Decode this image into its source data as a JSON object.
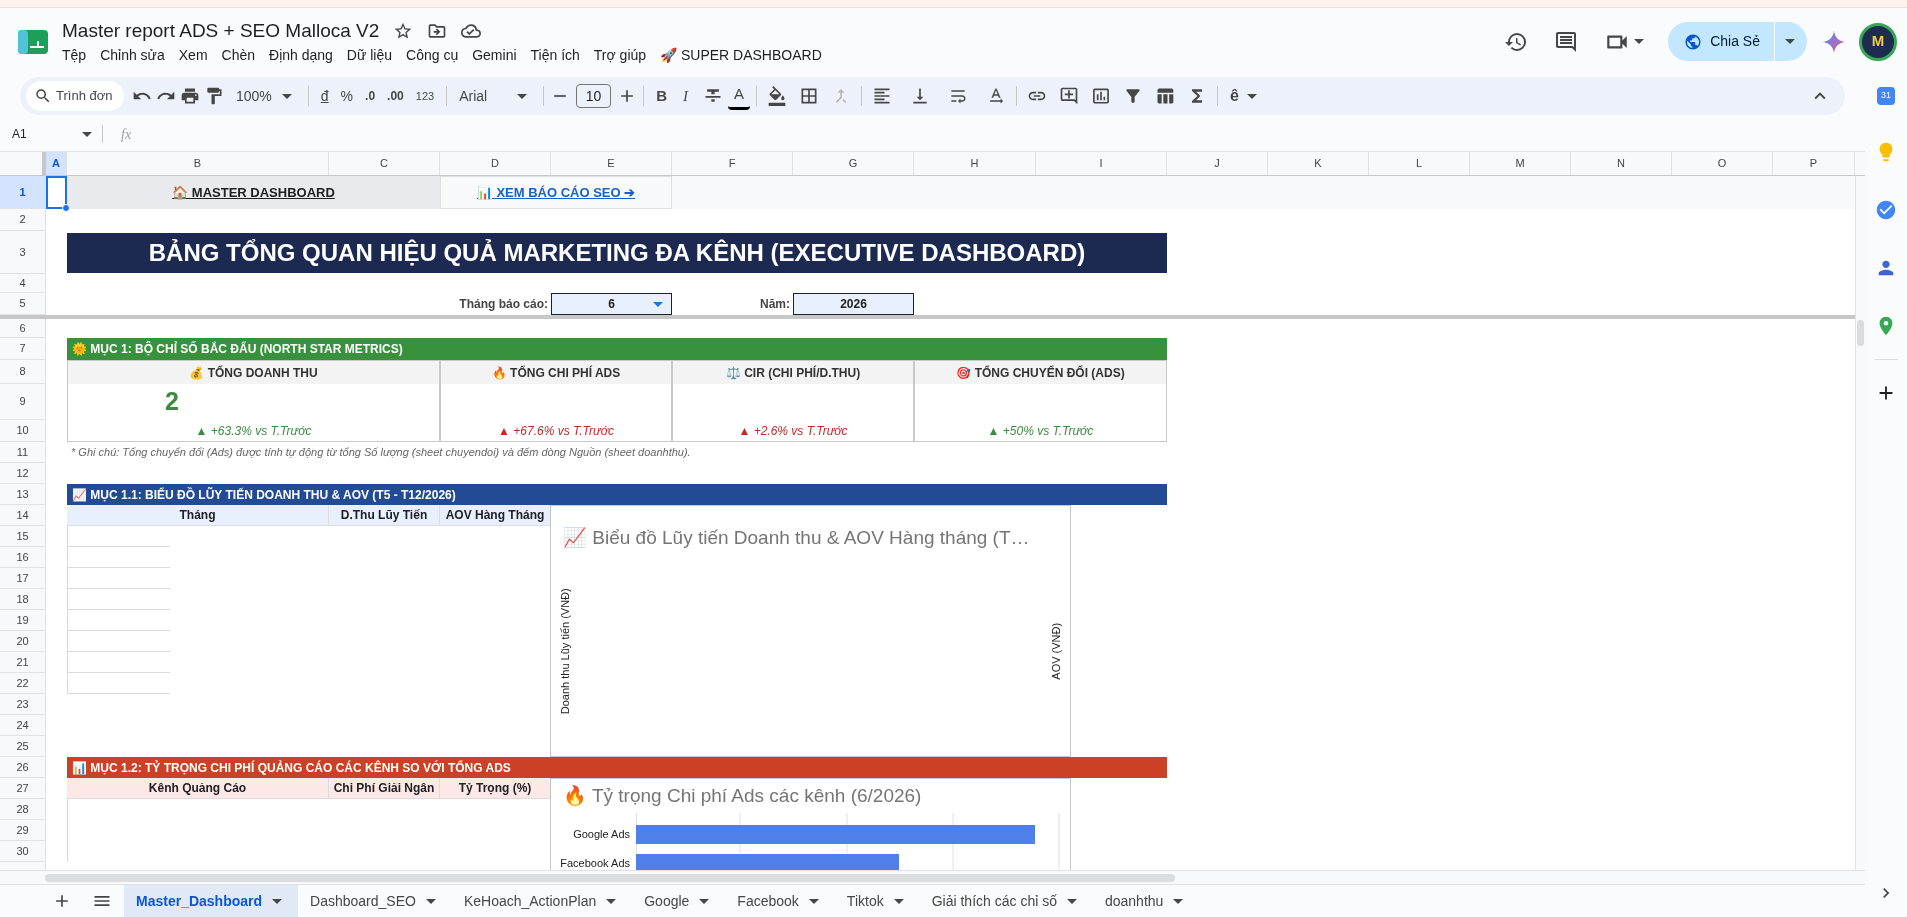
{
  "document": {
    "title": "Master report ADS + SEO Malloca V2",
    "menu": [
      "Tệp",
      "Chỉnh sửa",
      "Xem",
      "Chèn",
      "Định dạng",
      "Dữ liệu",
      "Công cụ",
      "Gemini",
      "Tiện ích",
      "Trợ giúp",
      "🚀 SUPER DASHBOARD"
    ]
  },
  "share_button": {
    "label": "Chia Sẻ"
  },
  "avatar": {
    "initial": "M"
  },
  "toolbar": {
    "search_placeholder": "Trình đơn",
    "zoom": "100%",
    "currency": "đ",
    "percent": "%",
    "decrease_decimals": ".0",
    "increase_decimals": ".00",
    "number_format": "123",
    "font": "Arial",
    "font_size": "10",
    "bold": "B",
    "italic": "I",
    "text_color": "A",
    "input_tools": "ê"
  },
  "formula_bar": {
    "name_box": "A1",
    "formula_label": "fx"
  },
  "columns": [
    {
      "label": "A",
      "selected": true
    },
    {
      "label": "B",
      "selected": false
    },
    {
      "label": "C",
      "selected": false
    },
    {
      "label": "D",
      "selected": false
    },
    {
      "label": "E",
      "selected": false
    },
    {
      "label": "F",
      "selected": false
    },
    {
      "label": "G",
      "selected": false
    },
    {
      "label": "H",
      "selected": false
    },
    {
      "label": "I",
      "selected": false
    },
    {
      "label": "J",
      "selected": false
    },
    {
      "label": "K",
      "selected": false
    },
    {
      "label": "L",
      "selected": false
    },
    {
      "label": "M",
      "selected": false
    },
    {
      "label": "N",
      "selected": false
    },
    {
      "label": "O",
      "selected": false
    },
    {
      "label": "P",
      "selected": false
    }
  ],
  "rows": [
    {
      "label": "1",
      "selected": true
    },
    {
      "label": "2",
      "selected": false
    },
    {
      "label": "3",
      "selected": false
    },
    {
      "label": "4",
      "selected": false
    },
    {
      "label": "5",
      "selected": false
    },
    {
      "label": "6",
      "selected": false
    },
    {
      "label": "7",
      "selected": false
    },
    {
      "label": "8",
      "selected": false
    },
    {
      "label": "9",
      "selected": false
    },
    {
      "label": "10",
      "selected": false
    },
    {
      "label": "11",
      "selected": false
    },
    {
      "label": "12",
      "selected": false
    },
    {
      "label": "13",
      "selected": false
    },
    {
      "label": "14",
      "selected": false
    },
    {
      "label": "15",
      "selected": false
    },
    {
      "label": "16",
      "selected": false
    },
    {
      "label": "17",
      "selected": false
    },
    {
      "label": "18",
      "selected": false
    },
    {
      "label": "19",
      "selected": false
    },
    {
      "label": "20",
      "selected": false
    },
    {
      "label": "21",
      "selected": false
    },
    {
      "label": "22",
      "selected": false
    },
    {
      "label": "23",
      "selected": false
    },
    {
      "label": "24",
      "selected": false
    },
    {
      "label": "25",
      "selected": false
    },
    {
      "label": "26",
      "selected": false
    },
    {
      "label": "27",
      "selected": false
    },
    {
      "label": "28",
      "selected": false
    },
    {
      "label": "29",
      "selected": false
    },
    {
      "label": "30",
      "selected": false
    }
  ],
  "links": [
    {
      "label": "🏠 MASTER DASHBOARD"
    },
    {
      "label": "📊 XEM BÁO CÁO SEO ➔"
    }
  ],
  "title": "BẢNG TỔNG QUAN HIỆU QUẢ MARKETING ĐA KÊNH (EXECUTIVE DASHBOARD)",
  "filters": [
    {
      "kind": "dropdown",
      "label": "Tháng báo cáo:",
      "value": "6"
    },
    {
      "kind": "field",
      "label": "Năm:",
      "value": "2026"
    }
  ],
  "section_1": {
    "heading": "🌞 MỤC 1: BỘ CHỈ SỐ BẮC ĐẨU (NORTH STAR METRICS)",
    "kpis": [
      {
        "label": "💰 TỔNG DOANH THU",
        "value": "2",
        "change": "▲ +63.3% vs T.Trước",
        "color": "#3d8b40"
      },
      {
        "label": "🔥 TỔNG CHI PHÍ ADS",
        "change": "▲ +67.6% vs T.Trước",
        "color": "#c62828"
      },
      {
        "label": "⚖️ CIR (CHI PHÍ/D.THU)",
        "change": "▲ +2.6% vs T.Trước",
        "color": "#c62828"
      },
      {
        "label": "🎯 TỔNG CHUYỂN ĐỔI (ADS)",
        "change": "▲ +50% vs T.Trước",
        "color": "#3d8b40"
      }
    ],
    "note": "* Ghi chú: Tổng chuyển đổi (Ads) được tính tự động từ tổng Số lượng (sheet chuyendoi) và đếm dòng Nguồn (sheet doanhthu)."
  },
  "section_1_1": {
    "heading": "📈 MỤC 1.1: BIỂU ĐỒ LŨY TIẾN DOANH THU & AOV (T5 - T12/2026)",
    "columns": [
      "Tháng",
      "D.Thu Lũy Tiến",
      "AOV Hàng Tháng"
    ],
    "chart": {
      "title": "📈 Biểu đồ Lũy tiến Doanh thu & AOV Hàng tháng (T…",
      "left_axis_label": "Doanh thu Lũy tiến (VNĐ)",
      "right_axis_label": "AOV (VNĐ)"
    }
  },
  "section_1_2": {
    "heading": "📊 MỤC 1.2: TỶ TRỌNG CHI PHÍ QUẢNG CÁO CÁC KÊNH SO VỚI TỔNG ADS",
    "columns": [
      "Kênh Quảng Cáo",
      "Chi Phí Giải Ngân",
      "Tỷ Trọng (%)"
    ],
    "chart": {
      "title": "🔥 Tỷ trọng Chi phí Ads các kênh (6/2026)",
      "bar_labels": [
        "Google Ads",
        "Facebook Ads"
      ]
    }
  },
  "sheet_tabs": [
    {
      "label": "Master_Dashboard",
      "selected": true
    },
    {
      "label": "Dashboard_SEO",
      "selected": false
    },
    {
      "label": "KeHoach_ActionPlan",
      "selected": false
    },
    {
      "label": "Google",
      "selected": false
    },
    {
      "label": "Facebook",
      "selected": false
    },
    {
      "label": "Tiktok",
      "selected": false
    },
    {
      "label": "Giải thích các chỉ số",
      "selected": false
    },
    {
      "label": "doanhthu",
      "selected": false
    }
  ],
  "side_panel": {
    "calendar_label": "31"
  }
}
